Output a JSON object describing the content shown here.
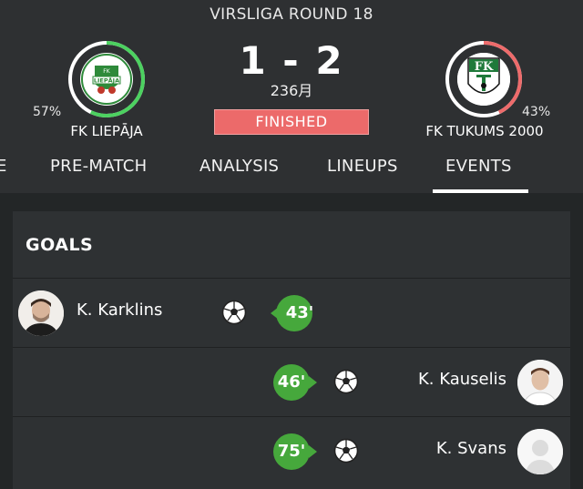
{
  "match": {
    "round": "VIRSLIGA ROUND 18",
    "score": "1 - 2",
    "date": "236月",
    "status": "FINISHED"
  },
  "home": {
    "name": "FK LIEPĀJA",
    "possession": "57%",
    "possession_value": 57,
    "logo_text": "LIEPĀJA",
    "logo_small": "FK",
    "ring_color": "#4cd160"
  },
  "away": {
    "name": "FK TUKUMS 2000",
    "possession": "43%",
    "possession_value": 43,
    "logo_text": "FK",
    "ring_color": "#ee6b6b"
  },
  "tabs": [
    {
      "label": "E"
    },
    {
      "label": "PRE-MATCH"
    },
    {
      "label": "ANALYSIS"
    },
    {
      "label": "LINEUPS"
    },
    {
      "label": "EVENTS",
      "active": true
    }
  ],
  "goals_panel": {
    "title": "GOALS",
    "events": [
      {
        "player": "K. Karklins",
        "minute": "43'",
        "side": "home"
      },
      {
        "player": "K. Kauselis",
        "minute": "46'",
        "side": "away"
      },
      {
        "player": "K. Svans",
        "minute": "75'",
        "side": "away"
      }
    ]
  },
  "icons": {
    "goal": "soccer-ball-icon",
    "avatar_placeholder": "person-silhouette-icon"
  },
  "colors": {
    "minute_badge": "#46a83c",
    "status_badge": "#ec6a6a",
    "home_ring": "#4cd160",
    "away_ring": "#ee6b6b"
  }
}
